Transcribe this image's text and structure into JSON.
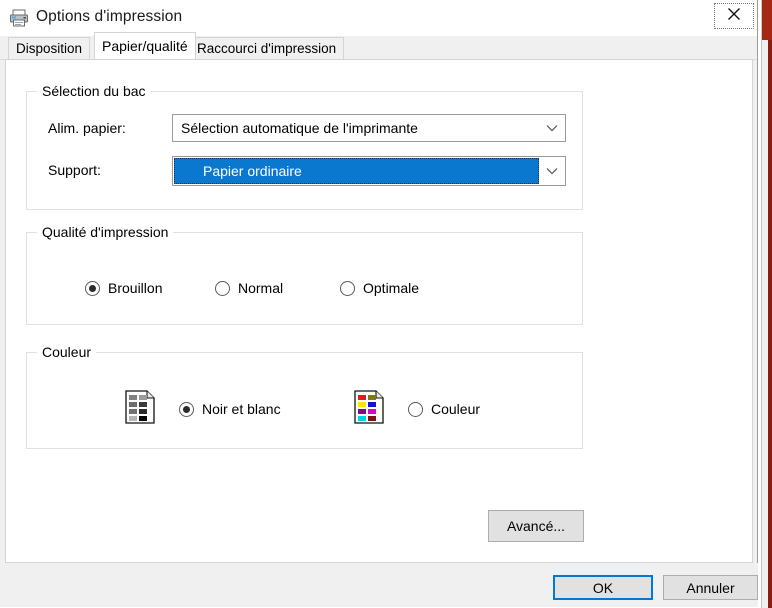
{
  "window": {
    "title": "Options d'impression",
    "icon": "printer-icon",
    "close_label": "×"
  },
  "tabs": [
    {
      "label": "Disposition",
      "active": false
    },
    {
      "label": "Papier/qualité",
      "active": true
    },
    {
      "label": "Raccourci d'impression",
      "active": false
    }
  ],
  "groups": {
    "tray": {
      "legend": "Sélection du bac",
      "fields": [
        {
          "label": "Alim. papier:",
          "value": "Sélection automatique de l'imprimante",
          "selected": false
        },
        {
          "label": "Support:",
          "value": "Papier ordinaire",
          "selected": true
        }
      ]
    },
    "quality": {
      "legend": "Qualité d'impression",
      "options": [
        {
          "label": "Brouillon",
          "checked": true
        },
        {
          "label": "Normal",
          "checked": false
        },
        {
          "label": "Optimale",
          "checked": false
        }
      ]
    },
    "color": {
      "legend": "Couleur",
      "options": [
        {
          "label": "Noir et blanc",
          "checked": true,
          "icon": "grayscale-page-icon"
        },
        {
          "label": "Couleur",
          "checked": false,
          "icon": "color-page-icon"
        }
      ]
    }
  },
  "buttons": {
    "advanced": "Avancé...",
    "ok": "OK",
    "cancel": "Annuler"
  },
  "colors": {
    "accent": "#0078d7",
    "selection_blue": "#0b78d0",
    "dialog_bg": "#f0f0f0",
    "panel_bg": "#ffffff",
    "button_face": "#e1e1e1",
    "bg_window_title": "#a52714"
  },
  "swatches": {
    "grayscale": [
      "#808080",
      "#9a9a9a",
      "#6e6e6e",
      "#3a3a3a",
      "#707070",
      "#2a2a2a",
      "#b4b4b4",
      "#000000"
    ],
    "color": [
      "#e01b24",
      "#7d7a16",
      "#ffe600",
      "#1414c8",
      "#7a0f7a",
      "#e000c8",
      "#00d2e6",
      "#7a1414"
    ]
  }
}
